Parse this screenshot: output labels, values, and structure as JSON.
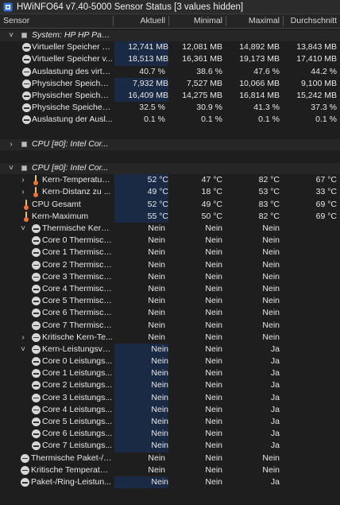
{
  "window": {
    "title": "HWiNFO64 v7.40-5000 Sensor Status [3 values hidden]"
  },
  "columns": [
    "Sensor",
    "Aktuell",
    "Minimal",
    "Maximal",
    "Durchschnitt"
  ],
  "rows": [
    {
      "type": "group",
      "name": "System: HP HP Pavili...",
      "expander": "˅",
      "indent": 0
    },
    {
      "type": "data",
      "icon": "circle",
      "name": "Virtueller Speicher z...",
      "v": [
        "12,741 MB",
        "12,081 MB",
        "14,892 MB",
        "13,843 MB"
      ],
      "hl": true
    },
    {
      "type": "data",
      "icon": "circle",
      "name": "Virtueller Speicher v...",
      "v": [
        "18,513 MB",
        "16,361 MB",
        "19,173 MB",
        "17,410 MB"
      ],
      "hl": true
    },
    {
      "type": "data",
      "icon": "circle",
      "name": "Auslastung des virtu...",
      "v": [
        "40.7 %",
        "38.6 %",
        "47.6 %",
        "44.2 %"
      ],
      "hl": false
    },
    {
      "type": "data",
      "icon": "circle",
      "name": "Physischer Speicher ...",
      "v": [
        "7,932 MB",
        "7,527 MB",
        "10,066 MB",
        "9,100 MB"
      ],
      "hl": true
    },
    {
      "type": "data",
      "icon": "circle",
      "name": "Physischer Speicher ...",
      "v": [
        "16,409 MB",
        "14,275 MB",
        "16,814 MB",
        "15,242 MB"
      ],
      "hl": true
    },
    {
      "type": "data",
      "icon": "circle",
      "name": "Physische Speicher-...",
      "v": [
        "32.5 %",
        "30.9 %",
        "41.3 %",
        "37.3 %"
      ],
      "hl": false
    },
    {
      "type": "data",
      "icon": "circle",
      "name": "Auslastung der Ausl...",
      "v": [
        "0.1 %",
        "0.1 %",
        "0.1 %",
        "0.1 %"
      ],
      "hl": false
    },
    {
      "type": "blank"
    },
    {
      "type": "group",
      "name": "CPU [#0]: Intel Cor...",
      "expander": "›",
      "indent": 0
    },
    {
      "type": "blank"
    },
    {
      "type": "group",
      "name": "CPU [#0]: Intel Cor...",
      "expander": "˅",
      "indent": 0
    },
    {
      "type": "data",
      "icon": "therm",
      "name": "Kern-Temperaturen",
      "expander": "›",
      "v": [
        "52 °C",
        "47 °C",
        "82 °C",
        "67 °C"
      ],
      "hl": true
    },
    {
      "type": "data",
      "icon": "therm",
      "name": "Kern-Distanz zu ...",
      "expander": "›",
      "v": [
        "49 °C",
        "18 °C",
        "53 °C",
        "33 °C"
      ],
      "hl": true
    },
    {
      "type": "data",
      "icon": "therm",
      "name": "CPU Gesamt",
      "v": [
        "52 °C",
        "49 °C",
        "83 °C",
        "69 °C"
      ],
      "hl": true
    },
    {
      "type": "data",
      "icon": "therm",
      "name": "Kern-Maximum",
      "v": [
        "55 °C",
        "50 °C",
        "82 °C",
        "69 °C"
      ],
      "hl": true
    },
    {
      "type": "data",
      "icon": "circle",
      "name": "Thermische Kern-...",
      "expander": "˅",
      "v": [
        "Nein",
        "Nein",
        "Nein",
        ""
      ],
      "hl": false
    },
    {
      "type": "data",
      "icon": "circle",
      "name": "Core 0 Thermisch...",
      "sub": true,
      "v": [
        "Nein",
        "Nein",
        "Nein",
        ""
      ],
      "hl": false
    },
    {
      "type": "data",
      "icon": "circle",
      "name": "Core 1 Thermisch...",
      "sub": true,
      "v": [
        "Nein",
        "Nein",
        "Nein",
        ""
      ],
      "hl": false
    },
    {
      "type": "data",
      "icon": "circle",
      "name": "Core 2 Thermisch...",
      "sub": true,
      "v": [
        "Nein",
        "Nein",
        "Nein",
        ""
      ],
      "hl": false
    },
    {
      "type": "data",
      "icon": "circle",
      "name": "Core 3 Thermisch...",
      "sub": true,
      "v": [
        "Nein",
        "Nein",
        "Nein",
        ""
      ],
      "hl": false
    },
    {
      "type": "data",
      "icon": "circle",
      "name": "Core 4 Thermisch...",
      "sub": true,
      "v": [
        "Nein",
        "Nein",
        "Nein",
        ""
      ],
      "hl": false
    },
    {
      "type": "data",
      "icon": "circle",
      "name": "Core 5 Thermisch...",
      "sub": true,
      "v": [
        "Nein",
        "Nein",
        "Nein",
        ""
      ],
      "hl": false
    },
    {
      "type": "data",
      "icon": "circle",
      "name": "Core 6 Thermisch...",
      "sub": true,
      "v": [
        "Nein",
        "Nein",
        "Nein",
        ""
      ],
      "hl": false
    },
    {
      "type": "data",
      "icon": "circle",
      "name": "Core 7 Thermisch...",
      "sub": true,
      "v": [
        "Nein",
        "Nein",
        "Nein",
        ""
      ],
      "hl": false
    },
    {
      "type": "data",
      "icon": "circle",
      "name": "Kritische Kern-Te...",
      "expander": "›",
      "v": [
        "Nein",
        "Nein",
        "Nein",
        ""
      ],
      "hl": false
    },
    {
      "type": "data",
      "icon": "circle",
      "name": "Kern-Leistungsve...",
      "expander": "˅",
      "v": [
        "Nein",
        "Nein",
        "Ja",
        ""
      ],
      "hl": true
    },
    {
      "type": "data",
      "icon": "circle",
      "name": "Core 0 Leistungs...",
      "sub": true,
      "v": [
        "Nein",
        "Nein",
        "Ja",
        ""
      ],
      "hl": true
    },
    {
      "type": "data",
      "icon": "circle",
      "name": "Core 1 Leistungs...",
      "sub": true,
      "v": [
        "Nein",
        "Nein",
        "Ja",
        ""
      ],
      "hl": true
    },
    {
      "type": "data",
      "icon": "circle",
      "name": "Core 2 Leistungs...",
      "sub": true,
      "v": [
        "Nein",
        "Nein",
        "Ja",
        ""
      ],
      "hl": true
    },
    {
      "type": "data",
      "icon": "circle",
      "name": "Core 3 Leistungs...",
      "sub": true,
      "v": [
        "Nein",
        "Nein",
        "Ja",
        ""
      ],
      "hl": true
    },
    {
      "type": "data",
      "icon": "circle",
      "name": "Core 4 Leistungs...",
      "sub": true,
      "v": [
        "Nein",
        "Nein",
        "Ja",
        ""
      ],
      "hl": true
    },
    {
      "type": "data",
      "icon": "circle",
      "name": "Core 5 Leistungs...",
      "sub": true,
      "v": [
        "Nein",
        "Nein",
        "Ja",
        ""
      ],
      "hl": true
    },
    {
      "type": "data",
      "icon": "circle",
      "name": "Core 6 Leistungs...",
      "sub": true,
      "v": [
        "Nein",
        "Nein",
        "Ja",
        ""
      ],
      "hl": true
    },
    {
      "type": "data",
      "icon": "circle",
      "name": "Core 7 Leistungs...",
      "sub": true,
      "v": [
        "Nein",
        "Nein",
        "Ja",
        ""
      ],
      "hl": true
    },
    {
      "type": "data",
      "icon": "circle",
      "name": "Thermische Paket-/R...",
      "root": true,
      "v": [
        "Nein",
        "Nein",
        "Nein",
        ""
      ],
      "hl": false
    },
    {
      "type": "data",
      "icon": "circle",
      "name": "Kritische Temperatur...",
      "root": true,
      "v": [
        "Nein",
        "Nein",
        "Nein",
        ""
      ],
      "hl": false
    },
    {
      "type": "data",
      "icon": "circle",
      "name": "Paket-/Ring-Leistun...",
      "root": true,
      "v": [
        "Nein",
        "Nein",
        "Ja",
        ""
      ],
      "hl": true
    }
  ]
}
